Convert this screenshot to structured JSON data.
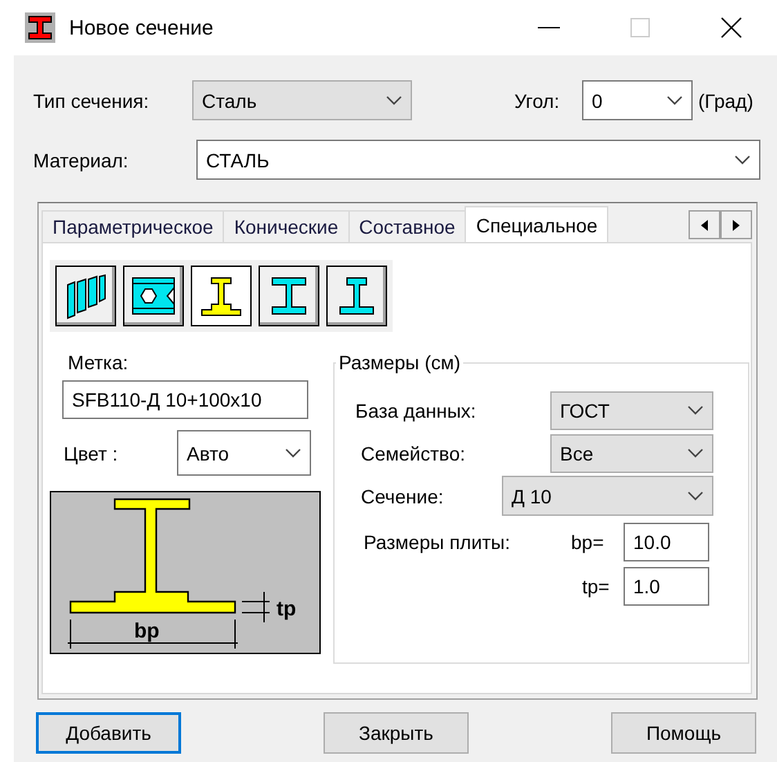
{
  "window": {
    "title": "Новое сечение"
  },
  "section_type": {
    "label": "Тип сечения:",
    "value": "Сталь"
  },
  "angle": {
    "label": "Угол:",
    "value": "0",
    "unit": "(Град)"
  },
  "material": {
    "label": "Материал:",
    "value": "СТАЛЬ"
  },
  "tabs": [
    {
      "label": "Параметрическое",
      "selected": false
    },
    {
      "label": "Конические",
      "selected": false
    },
    {
      "label": "Составное",
      "selected": false
    },
    {
      "label": "Специальное",
      "selected": true
    }
  ],
  "section_tools": [
    {
      "kind": "wall",
      "selected": false
    },
    {
      "kind": "plate",
      "selected": false
    },
    {
      "kind": "tee-plate",
      "selected": true
    },
    {
      "kind": "ibeam",
      "selected": false
    },
    {
      "kind": "ibeam-narrow",
      "selected": false
    }
  ],
  "mark": {
    "label": "Метка:",
    "value": "SFB110-Д 10+100x10"
  },
  "color": {
    "label": "Цвет :",
    "value": "Авто"
  },
  "preview": {
    "width_label": "bp",
    "thickness_label": "tp"
  },
  "dimensions": {
    "title": "Размеры (см)",
    "database": {
      "label": "База данных:",
      "value": "ГОСТ"
    },
    "family": {
      "label": "Семейство:",
      "value": "Все"
    },
    "section": {
      "label": "Сечение:",
      "value": "Д 10"
    },
    "plate_label": "Размеры плиты:",
    "bp": {
      "label": "bp=",
      "value": "10.0"
    },
    "tp": {
      "label": "tp=",
      "value": "1.0"
    }
  },
  "buttons": [
    {
      "label": "Добавить",
      "focused": true
    },
    {
      "label": "Закрыть",
      "focused": false
    },
    {
      "label": "Помощь",
      "focused": false
    }
  ]
}
